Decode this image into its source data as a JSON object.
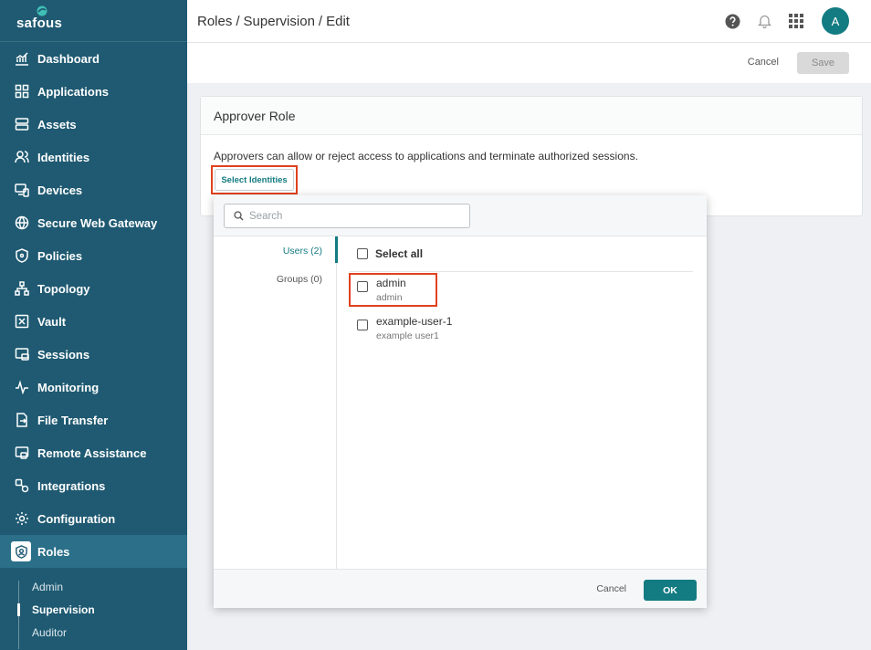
{
  "app": {
    "logo_text": "safous"
  },
  "sidebar": {
    "items": [
      {
        "label": "Dashboard",
        "icon": "chart-icon"
      },
      {
        "label": "Applications",
        "icon": "grid-icon"
      },
      {
        "label": "Assets",
        "icon": "server-icon"
      },
      {
        "label": "Identities",
        "icon": "users-icon"
      },
      {
        "label": "Devices",
        "icon": "devices-icon"
      },
      {
        "label": "Secure Web Gateway",
        "icon": "globe-icon"
      },
      {
        "label": "Policies",
        "icon": "shield-icon"
      },
      {
        "label": "Topology",
        "icon": "topology-icon"
      },
      {
        "label": "Vault",
        "icon": "vault-icon"
      },
      {
        "label": "Sessions",
        "icon": "sessions-icon"
      },
      {
        "label": "Monitoring",
        "icon": "pulse-icon"
      },
      {
        "label": "File Transfer",
        "icon": "file-transfer-icon"
      },
      {
        "label": "Remote Assistance",
        "icon": "remote-icon"
      },
      {
        "label": "Integrations",
        "icon": "integrations-icon"
      },
      {
        "label": "Configuration",
        "icon": "gear-icon"
      },
      {
        "label": "Roles",
        "icon": "role-shield-icon"
      }
    ],
    "subitems": [
      "Admin",
      "Supervision",
      "Auditor"
    ],
    "active_item": "Roles",
    "active_subitem": "Supervision"
  },
  "header": {
    "breadcrumb": [
      "Roles",
      "Supervision",
      "Edit"
    ],
    "separator": "/",
    "avatar_initial": "A"
  },
  "actions": {
    "cancel": "Cancel",
    "save": "Save"
  },
  "card": {
    "title": "Approver Role",
    "description": "Approvers can allow or reject access to applications and terminate authorized sessions.",
    "select_button": "Select Identities"
  },
  "picker": {
    "search_placeholder": "Search",
    "search_value": "",
    "tabs": [
      {
        "label": "Users (2)"
      },
      {
        "label": "Groups (0)"
      }
    ],
    "select_all": "Select all",
    "users": [
      {
        "name": "admin",
        "display": "admin"
      },
      {
        "name": "example-user-1",
        "display": "example user1"
      }
    ],
    "cancel": "Cancel",
    "ok": "OK"
  },
  "colors": {
    "sidebar_bg": "#1f5a72",
    "accent": "#137b82",
    "highlight": "#e0421e"
  }
}
